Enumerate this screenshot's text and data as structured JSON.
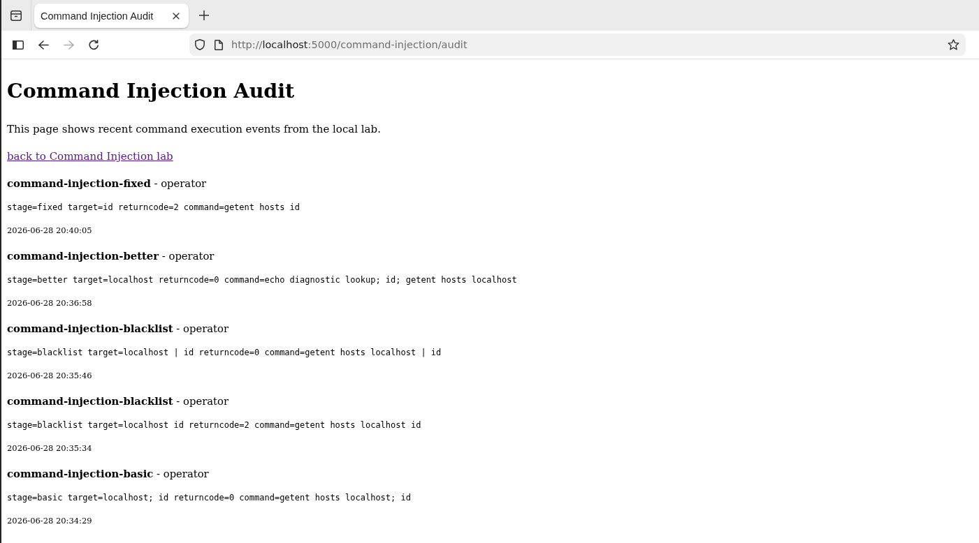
{
  "browser": {
    "tabs": [
      {
        "title": "Command Injection Audit",
        "selected": true
      }
    ],
    "nav_buttons": [
      {
        "kind": "sidebar",
        "disabled": false
      },
      {
        "kind": "back",
        "disabled": false
      },
      {
        "kind": "forward",
        "disabled": true
      },
      {
        "kind": "reload",
        "disabled": false
      }
    ],
    "address": {
      "scheme": "http://",
      "host": "localhost",
      "path": ":5000/command-injection/audit"
    }
  },
  "page": {
    "title": "Command Injection Audit",
    "intro": "This page shows recent command execution events from the local lab.",
    "back_link": {
      "text": "back to Command Injection lab",
      "visited": true
    },
    "events": [
      {
        "heading": "**command-injection-fixed** - operator",
        "details": "stage=fixed target=id returncode=2 command=getent hosts id",
        "time": "2026-06-28 20:40:05"
      },
      {
        "heading": "**command-injection-better** - operator",
        "details": "stage=better target=localhost returncode=0 command=echo diagnostic lookup; id; getent hosts localhost",
        "time": "2026-06-28 20:36:58"
      },
      {
        "heading": "**command-injection-blacklist** - operator",
        "details": "stage=blacklist target=localhost | id returncode=0 command=getent hosts localhost | id",
        "time": "2026-06-28 20:35:46"
      },
      {
        "heading": "**command-injection-blacklist** - operator",
        "details": "stage=blacklist target=localhost id returncode=2 command=getent hosts localhost id",
        "time": "2026-06-28 20:35:34"
      },
      {
        "heading": "**command-injection-basic** - operator",
        "details": "stage=basic target=localhost; id returncode=0 command=getent hosts localhost; id",
        "time": "2026-06-28 20:34:29"
      }
    ]
  }
}
